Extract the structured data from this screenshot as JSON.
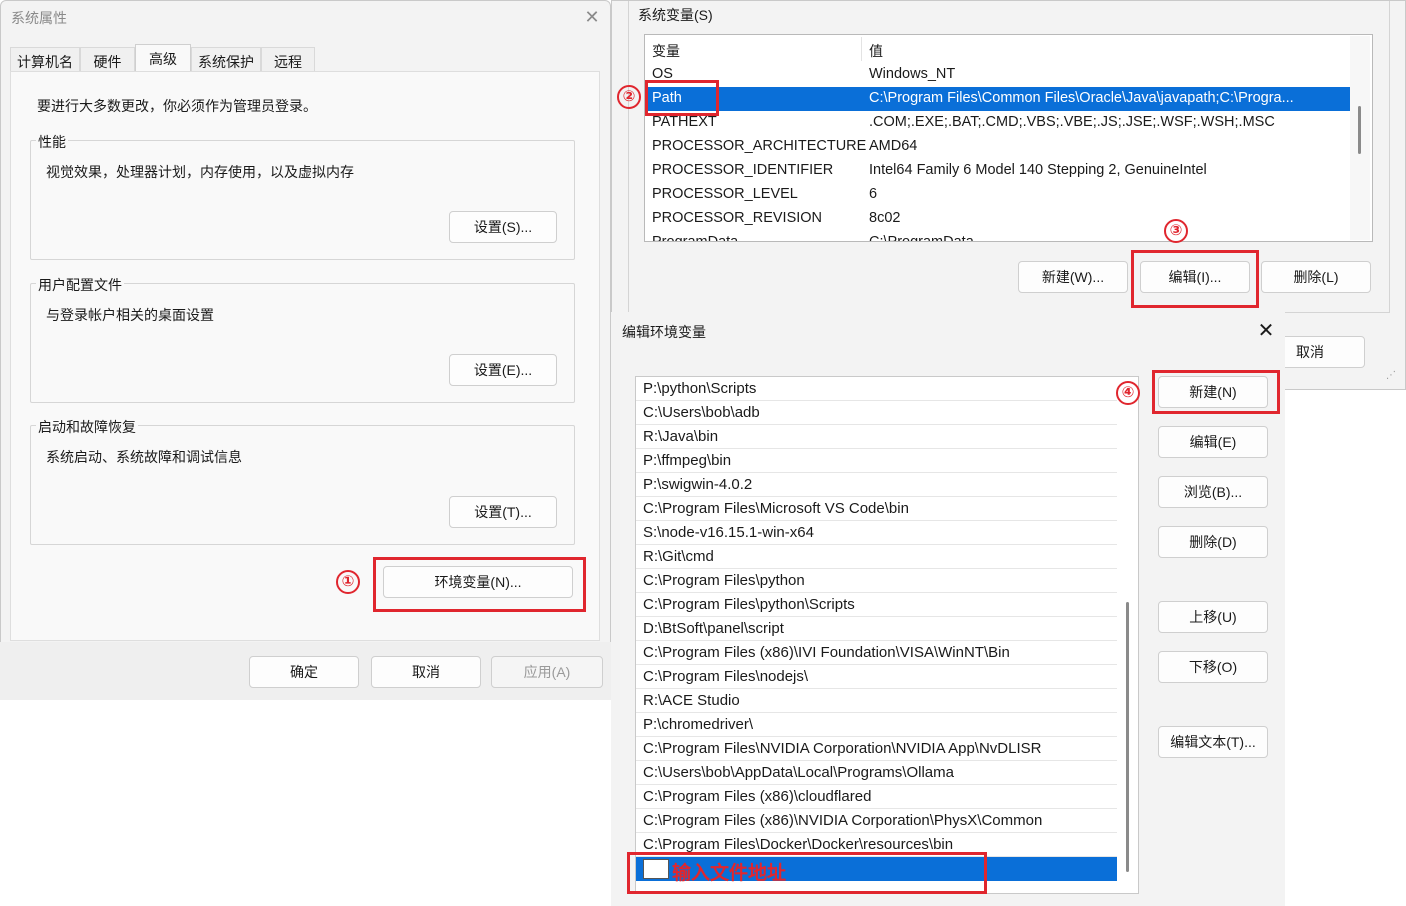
{
  "system_properties": {
    "title": "系统属性",
    "close_glyph": "✕",
    "tabs": [
      "计算机名",
      "硬件",
      "高级",
      "系统保护",
      "远程"
    ],
    "active_tab": "高级",
    "intro": "要进行大多数更改，你必须作为管理员登录。",
    "groups": [
      {
        "title": "性能",
        "desc": "视觉效果，处理器计划，内存使用，以及虚拟内存",
        "button": "设置(S)..."
      },
      {
        "title": "用户配置文件",
        "desc": "与登录帐户相关的桌面设置",
        "button": "设置(E)..."
      },
      {
        "title": "启动和故障恢复",
        "desc": "系统启动、系统故障和调试信息",
        "button": "设置(T)..."
      }
    ],
    "env_button": "环境变量(N)...",
    "footer": {
      "ok": "确定",
      "cancel": "取消",
      "apply": "应用(A)"
    }
  },
  "environment_variables": {
    "system_vars_title": "系统变量(S)",
    "columns": [
      "变量",
      "值"
    ],
    "rows": [
      {
        "name": "OS",
        "value": "Windows_NT"
      },
      {
        "name": "Path",
        "value": "C:\\Program Files\\Common Files\\Oracle\\Java\\javapath;C:\\Progra...",
        "selected": true
      },
      {
        "name": "PATHEXT",
        "value": ".COM;.EXE;.BAT;.CMD;.VBS;.VBE;.JS;.JSE;.WSF;.WSH;.MSC"
      },
      {
        "name": "PROCESSOR_ARCHITECTURE",
        "value": "AMD64"
      },
      {
        "name": "PROCESSOR_IDENTIFIER",
        "value": "Intel64 Family 6 Model 140 Stepping 2, GenuineIntel"
      },
      {
        "name": "PROCESSOR_LEVEL",
        "value": "6"
      },
      {
        "name": "PROCESSOR_REVISION",
        "value": "8c02"
      },
      {
        "name": "ProgramData",
        "value": "C:\\ProgramData"
      }
    ],
    "buttons": {
      "new": "新建(W)...",
      "edit": "编辑(I)...",
      "delete": "删除(L)"
    },
    "cancel": "取消"
  },
  "edit_env_var": {
    "title": "编辑环境变量",
    "close_glyph": "✕",
    "paths": [
      "P:\\python\\Scripts",
      "C:\\Users\\bob\\adb",
      "R:\\Java\\bin",
      "P:\\ffmpeg\\bin",
      "P:\\swigwin-4.0.2",
      "C:\\Program Files\\Microsoft VS Code\\bin",
      "S:\\node-v16.15.1-win-x64",
      "R:\\Git\\cmd",
      "C:\\Program Files\\python",
      "C:\\Program Files\\python\\Scripts",
      "D:\\BtSoft\\panel\\script",
      "C:\\Program Files (x86)\\IVI Foundation\\VISA\\WinNT\\Bin",
      "C:\\Program Files\\nodejs\\",
      "R:\\ACE Studio",
      "P:\\chromedriver\\",
      "C:\\Program Files\\NVIDIA Corporation\\NVIDIA App\\NvDLISR",
      "C:\\Users\\bob\\AppData\\Local\\Programs\\Ollama",
      "C:\\Program Files (x86)\\cloudflared",
      "C:\\Program Files (x86)\\NVIDIA Corporation\\PhysX\\Common",
      "C:\\Program Files\\Docker\\Docker\\resources\\bin"
    ],
    "new_entry_hint": "输入文件地址",
    "buttons": {
      "new": "新建(N)",
      "edit": "编辑(E)",
      "browse": "浏览(B)...",
      "delete": "删除(D)",
      "move_up": "上移(U)",
      "move_down": "下移(O)",
      "edit_text": "编辑文本(T)..."
    }
  },
  "annotations": {
    "markers": [
      "①",
      "②",
      "③",
      "④"
    ],
    "color": "#e0262e"
  }
}
